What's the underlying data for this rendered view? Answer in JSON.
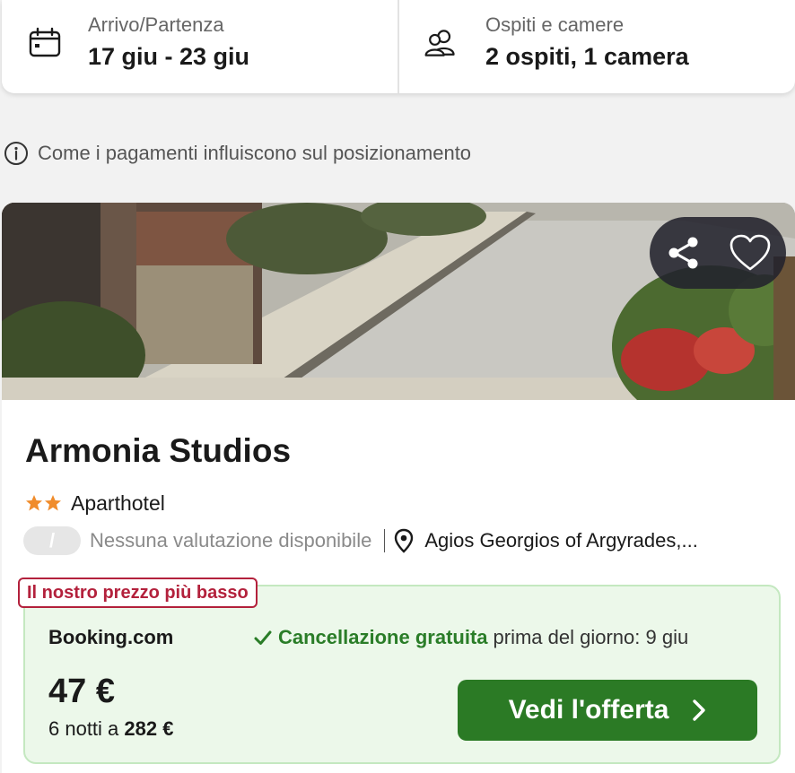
{
  "search": {
    "dates": {
      "label": "Arrivo/Partenza",
      "value": "17 giu - 23 giu",
      "icon": "calendar-icon"
    },
    "guests": {
      "label": "Ospiti e camere",
      "value": "2 ospiti, 1 camera",
      "icon": "users-icon"
    }
  },
  "payment_info": {
    "icon": "info-icon",
    "text": "Come i pagamenti influiscono sul posizionamento"
  },
  "hotel": {
    "name": "Armonia Studios",
    "stars": 2,
    "type": "Aparthotel",
    "rating_badge": "/",
    "rating_text": "Nessuna valutazione disponibile",
    "location": "Agios Georgios of Argyrades,...",
    "actions": {
      "share_icon": "share-icon",
      "favorite_icon": "heart-icon"
    }
  },
  "deal": {
    "badge": "Il nostro prezzo più basso",
    "provider": "Booking.com",
    "cancellation_free": "Cancellazione gratuita",
    "cancellation_until": "prima del giorno: 9 giu",
    "price": "47 €",
    "nights_prefix": "6 notti a",
    "nights_total": "282 €",
    "cta": "Vedi l'offerta"
  },
  "colors": {
    "accent_green": "#2b7a25",
    "cancel_green": "#2a7d28",
    "badge_red": "#b3213c",
    "star_orange": "#f08c2c",
    "deal_bg": "#ecf8ea"
  }
}
